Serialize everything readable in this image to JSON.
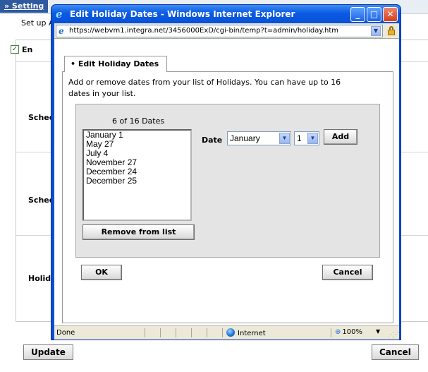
{
  "background": {
    "settings_label": "» Setting",
    "setup_text": "Set up A",
    "enable_label": "En",
    "rows": [
      {
        "label": "Sched"
      },
      {
        "label": "Sched"
      },
      {
        "label": "Holid"
      }
    ],
    "update_button": "Update",
    "cancel_button": "Cancel"
  },
  "window": {
    "title": "Edit Holiday Dates - Windows Internet Explorer",
    "url": "https://webvm1.integra.net/3456000ExD/cgi-bin/temp?t=admin/holiday.htm",
    "status_text": "Done",
    "zone": "Internet",
    "zoom": "100%"
  },
  "dialog": {
    "tab_label": "• Edit Holiday Dates",
    "description": "Add or remove dates from your list of Holidays. You can have up to 16 dates in your list.",
    "count_text": "6 of 16 Dates",
    "dates": [
      "January 1",
      "May 27",
      "July 4",
      "November 27",
      "December 24",
      "December 25"
    ],
    "remove_button": "Remove from list",
    "date_label": "Date",
    "month_value": "January",
    "day_value": "1",
    "add_button": "Add",
    "ok_button": "OK",
    "cancel_button": "Cancel"
  },
  "colors": {
    "title_bar": "#0b5ae3",
    "panel_gray": "#e4e4e4"
  }
}
